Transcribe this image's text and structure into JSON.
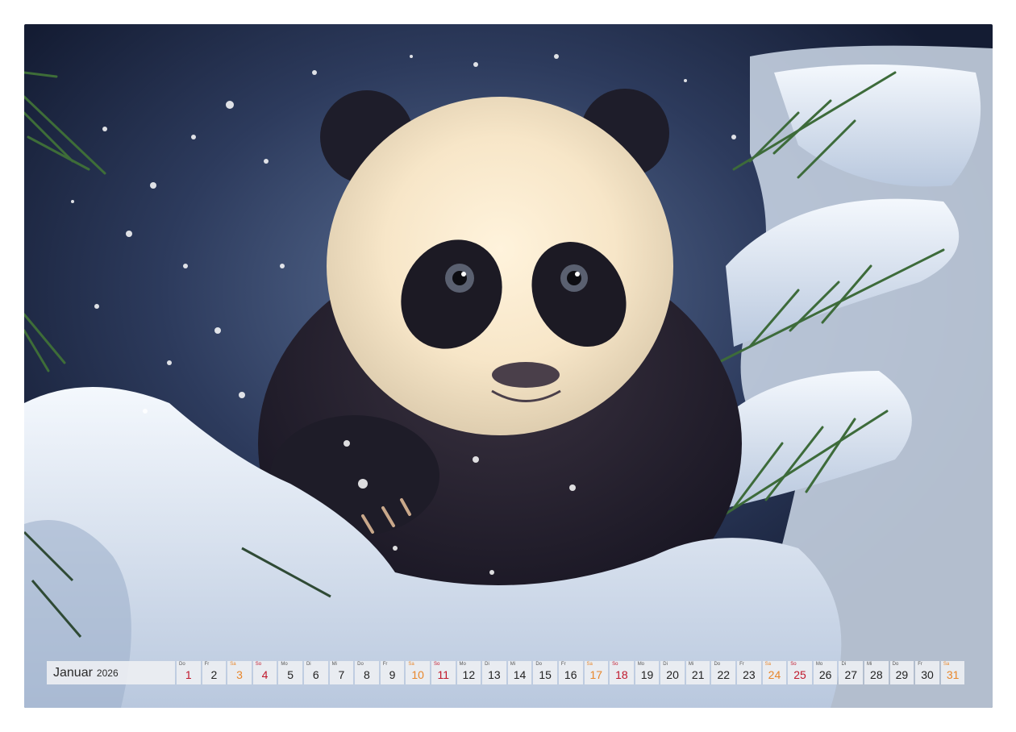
{
  "calendar": {
    "month": "Januar",
    "year": "2026",
    "days": [
      {
        "wd": "Do",
        "num": "1",
        "type": "hol"
      },
      {
        "wd": "Fr",
        "num": "2",
        "type": ""
      },
      {
        "wd": "Sa",
        "num": "3",
        "type": "sat"
      },
      {
        "wd": "So",
        "num": "4",
        "type": "sun"
      },
      {
        "wd": "Mo",
        "num": "5",
        "type": ""
      },
      {
        "wd": "Di",
        "num": "6",
        "type": ""
      },
      {
        "wd": "Mi",
        "num": "7",
        "type": ""
      },
      {
        "wd": "Do",
        "num": "8",
        "type": ""
      },
      {
        "wd": "Fr",
        "num": "9",
        "type": ""
      },
      {
        "wd": "Sa",
        "num": "10",
        "type": "sat"
      },
      {
        "wd": "So",
        "num": "11",
        "type": "sun"
      },
      {
        "wd": "Mo",
        "num": "12",
        "type": ""
      },
      {
        "wd": "Di",
        "num": "13",
        "type": ""
      },
      {
        "wd": "Mi",
        "num": "14",
        "type": ""
      },
      {
        "wd": "Do",
        "num": "15",
        "type": ""
      },
      {
        "wd": "Fr",
        "num": "16",
        "type": ""
      },
      {
        "wd": "Sa",
        "num": "17",
        "type": "sat"
      },
      {
        "wd": "So",
        "num": "18",
        "type": "sun"
      },
      {
        "wd": "Mo",
        "num": "19",
        "type": ""
      },
      {
        "wd": "Di",
        "num": "20",
        "type": ""
      },
      {
        "wd": "Mi",
        "num": "21",
        "type": ""
      },
      {
        "wd": "Do",
        "num": "22",
        "type": ""
      },
      {
        "wd": "Fr",
        "num": "23",
        "type": ""
      },
      {
        "wd": "Sa",
        "num": "24",
        "type": "sat"
      },
      {
        "wd": "So",
        "num": "25",
        "type": "sun"
      },
      {
        "wd": "Mo",
        "num": "26",
        "type": ""
      },
      {
        "wd": "Di",
        "num": "27",
        "type": ""
      },
      {
        "wd": "Mi",
        "num": "28",
        "type": ""
      },
      {
        "wd": "Do",
        "num": "29",
        "type": ""
      },
      {
        "wd": "Fr",
        "num": "30",
        "type": ""
      },
      {
        "wd": "Sa",
        "num": "31",
        "type": "sat"
      }
    ]
  },
  "colors": {
    "saturday": "#e8862a",
    "sunday": "#c0172b"
  }
}
